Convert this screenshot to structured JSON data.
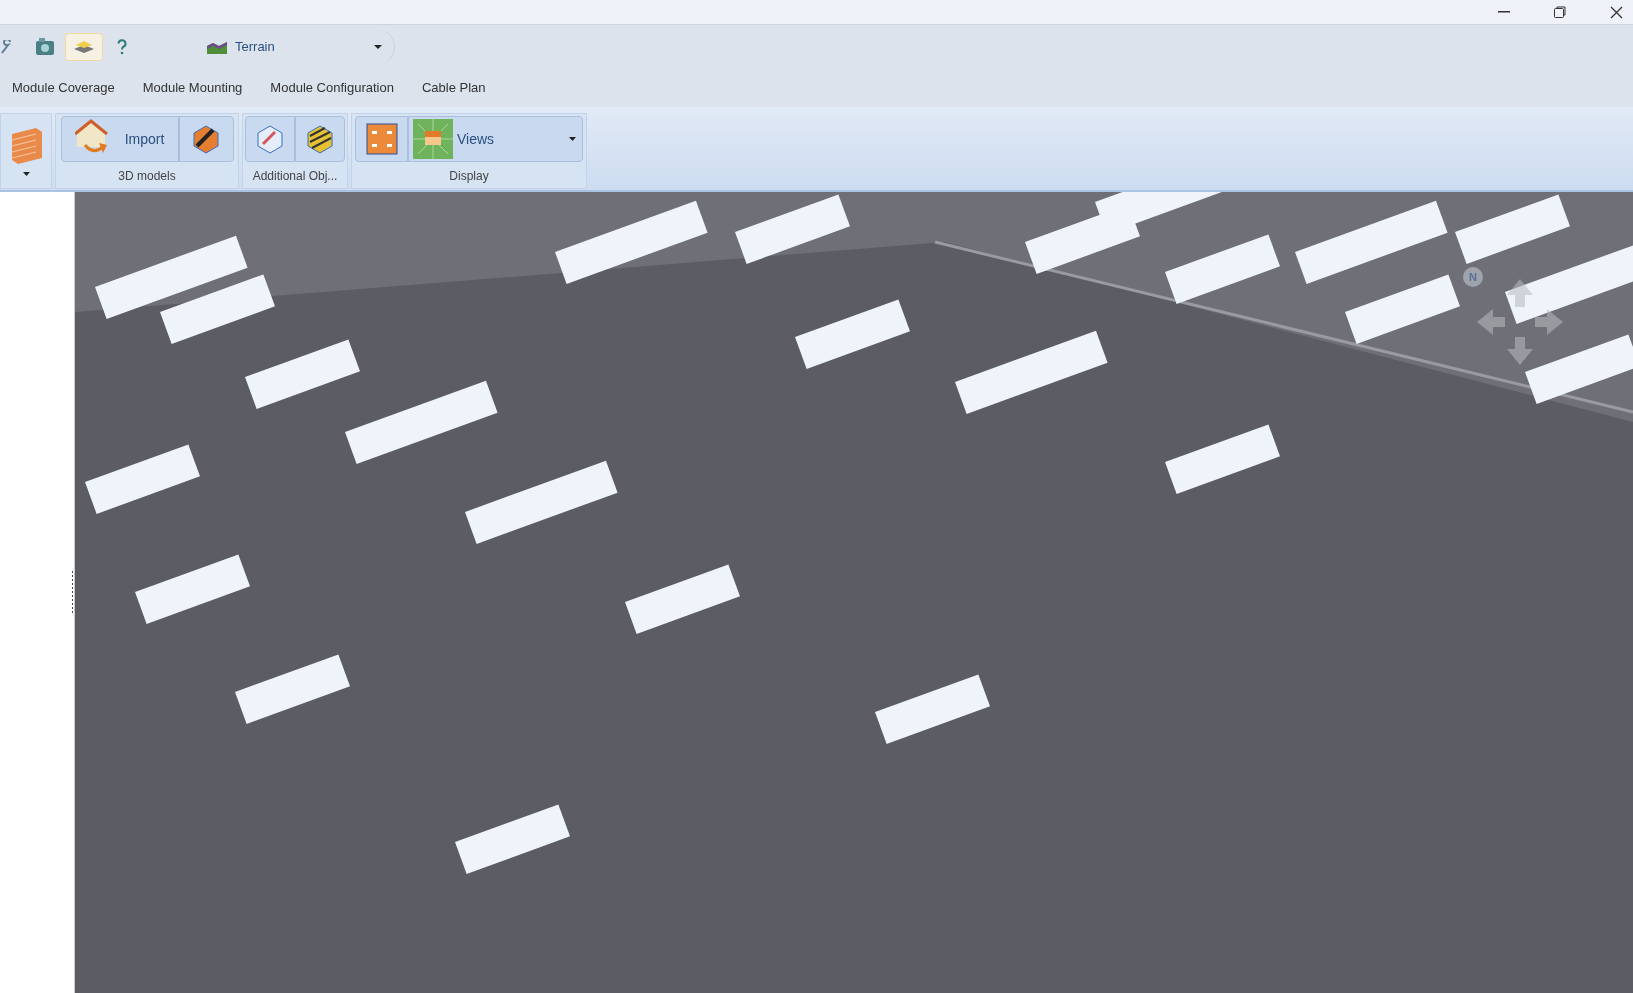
{
  "quick_toolbar": {
    "terrain_dropdown": {
      "value": "Terrain"
    }
  },
  "tabs": [
    {
      "label": "Module Coverage",
      "selected": false
    },
    {
      "label": "Module Mounting",
      "selected": false
    },
    {
      "label": "Module Configuration",
      "selected": false
    },
    {
      "label": "Cable Plan",
      "selected": false
    }
  ],
  "ribbon": {
    "groups": [
      {
        "label": "3D models",
        "button": "Import"
      },
      {
        "label": "Additional Obj..."
      },
      {
        "label": "Display",
        "button": "Views"
      }
    ]
  },
  "viewport": {
    "compass": "N"
  }
}
